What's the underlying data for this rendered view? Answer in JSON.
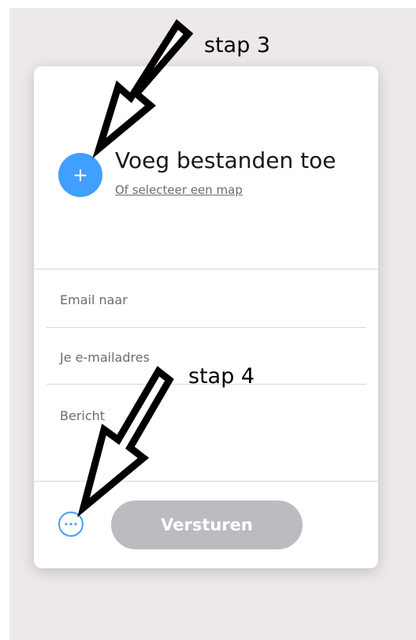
{
  "upload": {
    "add_icon": "plus-icon",
    "title": "Voeg bestanden toe",
    "folder_link": "Of selecteer een map"
  },
  "form": {
    "email_to_placeholder": "Email naar",
    "your_email_placeholder": "Je e-mailadres",
    "message_placeholder": "Bericht"
  },
  "footer": {
    "more_icon": "more-options-icon",
    "send_label": "Versturen"
  },
  "annotations": {
    "step3": "stap 3",
    "step4": "stap 4"
  },
  "colors": {
    "accent": "#409fff",
    "send_disabled": "#babcbf",
    "background": "#ede9e8"
  }
}
